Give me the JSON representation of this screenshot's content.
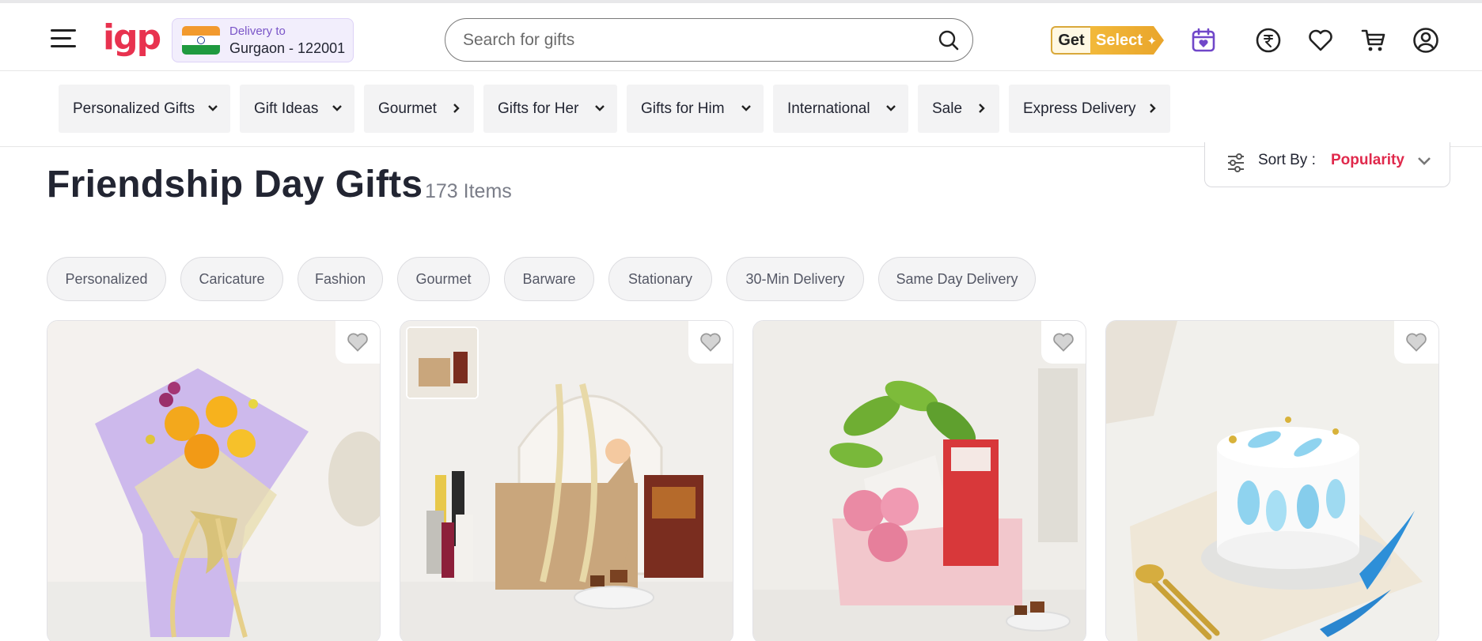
{
  "header": {
    "logo_text": "igp",
    "delivery_label": "Delivery to",
    "delivery_location": "Gurgaon - 122001",
    "search_placeholder": "Search for gifts",
    "getselect_get": "Get",
    "getselect_select": "Select",
    "brand_color": "#e8324f"
  },
  "nav": {
    "categories": [
      {
        "label": "Personalized Gifts",
        "chevron": "chevron-down"
      },
      {
        "label": "Gift Ideas",
        "chevron": "chevron-down"
      },
      {
        "label": "Gourmet",
        "chevron": "chevron-right"
      },
      {
        "label": "Gifts for Her",
        "chevron": "chevron-down"
      },
      {
        "label": "Gifts for Him",
        "chevron": "chevron-down"
      },
      {
        "label": "International",
        "chevron": "chevron-down"
      },
      {
        "label": "Sale",
        "chevron": "chevron-right"
      },
      {
        "label": "Express Delivery",
        "chevron": "chevron-right"
      }
    ]
  },
  "page": {
    "title": "Friendship Day Gifts",
    "item_count": "173 Items",
    "sort_label": "Sort By :",
    "sort_value": "Popularity"
  },
  "filters": [
    "Personalized",
    "Caricature",
    "Fashion",
    "Gourmet",
    "Barware",
    "Stationary",
    "30-Min Delivery",
    "Same Day Delivery"
  ],
  "products": [
    {
      "image": "flower-bouquet",
      "colors": [
        "#f4f1ee",
        "#cdb9ec"
      ]
    },
    {
      "image": "gift-hamper-perfumes",
      "colors": [
        "#f1efec",
        "#c9a67c"
      ]
    },
    {
      "image": "plant-roses-box",
      "colors": [
        "#efede9",
        "#f2c7cc"
      ]
    },
    {
      "image": "blue-white-cake",
      "colors": [
        "#f1f0ec",
        "#e9e9e9"
      ]
    }
  ]
}
